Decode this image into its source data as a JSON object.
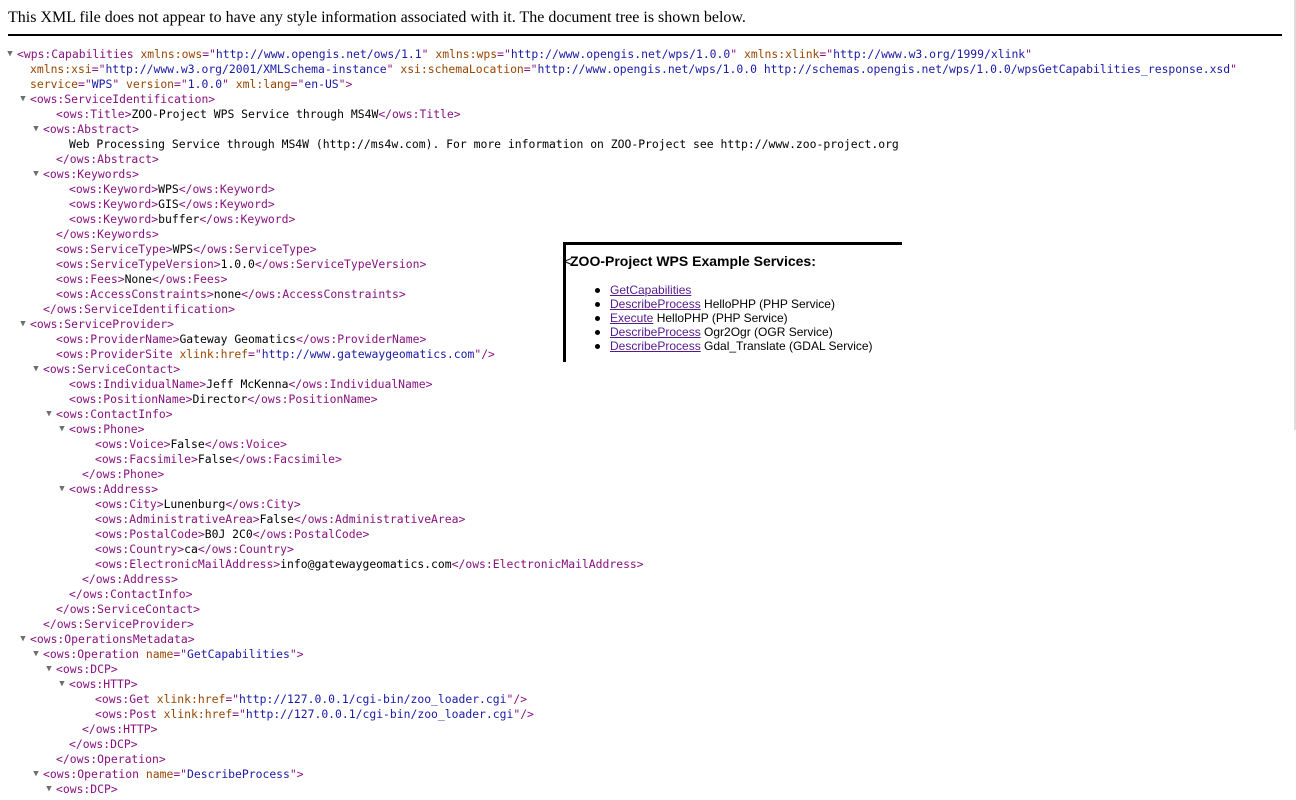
{
  "header": {
    "notice": "This XML file does not appear to have any style information associated with it. The document tree is shown below."
  },
  "xml_lines": [
    {
      "indent": 0,
      "toggle": true,
      "parts": [
        [
          "t",
          "<wps:Capabilities"
        ],
        [
          "s",
          " "
        ],
        [
          "an",
          "xmlns:ows"
        ],
        [
          "t",
          "=\""
        ],
        [
          "av",
          "http://www.opengis.net/ows/1.1"
        ],
        [
          "t",
          "\""
        ],
        [
          "s",
          " "
        ],
        [
          "an",
          "xmlns:wps"
        ],
        [
          "t",
          "=\""
        ],
        [
          "av",
          "http://www.opengis.net/wps/1.0.0"
        ],
        [
          "t",
          "\""
        ],
        [
          "s",
          " "
        ],
        [
          "an",
          "xmlns:xlink"
        ],
        [
          "t",
          "=\""
        ],
        [
          "av",
          "http://www.w3.org/1999/xlink"
        ],
        [
          "t",
          "\""
        ]
      ]
    },
    {
      "indent": 1,
      "parts": [
        [
          "an",
          "xmlns:xsi"
        ],
        [
          "t",
          "=\""
        ],
        [
          "av",
          "http://www.w3.org/2001/XMLSchema-instance"
        ],
        [
          "t",
          "\""
        ],
        [
          "s",
          " "
        ],
        [
          "an",
          "xsi:schemaLocation"
        ],
        [
          "t",
          "=\""
        ],
        [
          "av",
          "http://www.opengis.net/wps/1.0.0 http://schemas.opengis.net/wps/1.0.0/wpsGetCapabilities_response.xsd"
        ],
        [
          "t",
          "\""
        ]
      ]
    },
    {
      "indent": 1,
      "parts": [
        [
          "an",
          "service"
        ],
        [
          "t",
          "=\""
        ],
        [
          "av",
          "WPS"
        ],
        [
          "t",
          "\""
        ],
        [
          "s",
          " "
        ],
        [
          "an",
          "version"
        ],
        [
          "t",
          "=\""
        ],
        [
          "av",
          "1.0.0"
        ],
        [
          "t",
          "\""
        ],
        [
          "s",
          " "
        ],
        [
          "an",
          "xml:lang"
        ],
        [
          "t",
          "=\""
        ],
        [
          "av",
          "en-US"
        ],
        [
          "t",
          "\">"
        ]
      ]
    },
    {
      "indent": 1,
      "toggle": true,
      "parts": [
        [
          "t",
          "<ows:ServiceIdentification>"
        ]
      ]
    },
    {
      "indent": 3,
      "parts": [
        [
          "t",
          "<ows:Title>"
        ],
        [
          "tx",
          "ZOO-Project WPS Service through MS4W"
        ],
        [
          "t",
          "</ows:Title>"
        ]
      ]
    },
    {
      "indent": 2,
      "toggle": true,
      "parts": [
        [
          "t",
          "<ows:Abstract>"
        ]
      ]
    },
    {
      "indent": 4,
      "parts": [
        [
          "tx",
          "Web Processing Service through MS4W (http://ms4w.com). For more information on ZOO-Project see http://www.zoo-project.org"
        ]
      ]
    },
    {
      "indent": 3,
      "parts": [
        [
          "t",
          "</ows:Abstract>"
        ]
      ]
    },
    {
      "indent": 2,
      "toggle": true,
      "parts": [
        [
          "t",
          "<ows:Keywords>"
        ]
      ]
    },
    {
      "indent": 4,
      "parts": [
        [
          "t",
          "<ows:Keyword>"
        ],
        [
          "tx",
          "WPS"
        ],
        [
          "t",
          "</ows:Keyword>"
        ]
      ]
    },
    {
      "indent": 4,
      "parts": [
        [
          "t",
          "<ows:Keyword>"
        ],
        [
          "tx",
          "GIS"
        ],
        [
          "t",
          "</ows:Keyword>"
        ]
      ]
    },
    {
      "indent": 4,
      "parts": [
        [
          "t",
          "<ows:Keyword>"
        ],
        [
          "tx",
          "buffer"
        ],
        [
          "t",
          "</ows:Keyword>"
        ]
      ]
    },
    {
      "indent": 3,
      "parts": [
        [
          "t",
          "</ows:Keywords>"
        ]
      ]
    },
    {
      "indent": 3,
      "parts": [
        [
          "t",
          "<ows:ServiceType>"
        ],
        [
          "tx",
          "WPS"
        ],
        [
          "t",
          "</ows:ServiceType>"
        ]
      ]
    },
    {
      "indent": 3,
      "parts": [
        [
          "t",
          "<ows:ServiceTypeVersion>"
        ],
        [
          "tx",
          "1.0.0"
        ],
        [
          "t",
          "</ows:ServiceTypeVersion>"
        ]
      ]
    },
    {
      "indent": 3,
      "parts": [
        [
          "t",
          "<ows:Fees>"
        ],
        [
          "tx",
          "None"
        ],
        [
          "t",
          "</ows:Fees>"
        ]
      ]
    },
    {
      "indent": 3,
      "parts": [
        [
          "t",
          "<ows:AccessConstraints>"
        ],
        [
          "tx",
          "none"
        ],
        [
          "t",
          "</ows:AccessConstraints>"
        ]
      ]
    },
    {
      "indent": 2,
      "parts": [
        [
          "t",
          "</ows:ServiceIdentification>"
        ]
      ]
    },
    {
      "indent": 1,
      "toggle": true,
      "parts": [
        [
          "t",
          "<ows:ServiceProvider>"
        ]
      ]
    },
    {
      "indent": 3,
      "parts": [
        [
          "t",
          "<ows:ProviderName>"
        ],
        [
          "tx",
          "Gateway Geomatics"
        ],
        [
          "t",
          "</ows:ProviderName>"
        ]
      ]
    },
    {
      "indent": 3,
      "parts": [
        [
          "t",
          "<ows:ProviderSite"
        ],
        [
          "s",
          " "
        ],
        [
          "an",
          "xlink:href"
        ],
        [
          "t",
          "=\""
        ],
        [
          "av",
          "http://www.gatewaygeomatics.com"
        ],
        [
          "t",
          "\"/>"
        ]
      ]
    },
    {
      "indent": 2,
      "toggle": true,
      "parts": [
        [
          "t",
          "<ows:ServiceContact>"
        ]
      ]
    },
    {
      "indent": 4,
      "parts": [
        [
          "t",
          "<ows:IndividualName>"
        ],
        [
          "tx",
          "Jeff McKenna"
        ],
        [
          "t",
          "</ows:IndividualName>"
        ]
      ]
    },
    {
      "indent": 4,
      "parts": [
        [
          "t",
          "<ows:PositionName>"
        ],
        [
          "tx",
          "Director"
        ],
        [
          "t",
          "</ows:PositionName>"
        ]
      ]
    },
    {
      "indent": 3,
      "toggle": true,
      "parts": [
        [
          "t",
          "<ows:ContactInfo>"
        ]
      ]
    },
    {
      "indent": 4,
      "toggle": true,
      "parts": [
        [
          "t",
          "<ows:Phone>"
        ]
      ]
    },
    {
      "indent": 6,
      "parts": [
        [
          "t",
          "<ows:Voice>"
        ],
        [
          "tx",
          "False"
        ],
        [
          "t",
          "</ows:Voice>"
        ]
      ]
    },
    {
      "indent": 6,
      "parts": [
        [
          "t",
          "<ows:Facsimile>"
        ],
        [
          "tx",
          "False"
        ],
        [
          "t",
          "</ows:Facsimile>"
        ]
      ]
    },
    {
      "indent": 5,
      "parts": [
        [
          "t",
          "</ows:Phone>"
        ]
      ]
    },
    {
      "indent": 4,
      "toggle": true,
      "parts": [
        [
          "t",
          "<ows:Address>"
        ]
      ]
    },
    {
      "indent": 6,
      "parts": [
        [
          "t",
          "<ows:City>"
        ],
        [
          "tx",
          "Lunenburg"
        ],
        [
          "t",
          "</ows:City>"
        ]
      ]
    },
    {
      "indent": 6,
      "parts": [
        [
          "t",
          "<ows:AdministrativeArea>"
        ],
        [
          "tx",
          "False"
        ],
        [
          "t",
          "</ows:AdministrativeArea>"
        ]
      ]
    },
    {
      "indent": 6,
      "parts": [
        [
          "t",
          "<ows:PostalCode>"
        ],
        [
          "tx",
          "B0J 2C0"
        ],
        [
          "t",
          "</ows:PostalCode>"
        ]
      ]
    },
    {
      "indent": 6,
      "parts": [
        [
          "t",
          "<ows:Country>"
        ],
        [
          "tx",
          "ca"
        ],
        [
          "t",
          "</ows:Country>"
        ]
      ]
    },
    {
      "indent": 6,
      "parts": [
        [
          "t",
          "<ows:ElectronicMailAddress>"
        ],
        [
          "tx",
          "info@gatewaygeomatics.com"
        ],
        [
          "t",
          "</ows:ElectronicMailAddress>"
        ]
      ]
    },
    {
      "indent": 5,
      "parts": [
        [
          "t",
          "</ows:Address>"
        ]
      ]
    },
    {
      "indent": 4,
      "parts": [
        [
          "t",
          "</ows:ContactInfo>"
        ]
      ]
    },
    {
      "indent": 3,
      "parts": [
        [
          "t",
          "</ows:ServiceContact>"
        ]
      ]
    },
    {
      "indent": 2,
      "parts": [
        [
          "t",
          "</ows:ServiceProvider>"
        ]
      ]
    },
    {
      "indent": 1,
      "toggle": true,
      "parts": [
        [
          "t",
          "<ows:OperationsMetadata>"
        ]
      ]
    },
    {
      "indent": 2,
      "toggle": true,
      "parts": [
        [
          "t",
          "<ows:Operation"
        ],
        [
          "s",
          " "
        ],
        [
          "an",
          "name"
        ],
        [
          "t",
          "=\""
        ],
        [
          "av",
          "GetCapabilities"
        ],
        [
          "t",
          "\">"
        ]
      ]
    },
    {
      "indent": 3,
      "toggle": true,
      "parts": [
        [
          "t",
          "<ows:DCP>"
        ]
      ]
    },
    {
      "indent": 4,
      "toggle": true,
      "parts": [
        [
          "t",
          "<ows:HTTP>"
        ]
      ]
    },
    {
      "indent": 6,
      "parts": [
        [
          "t",
          "<ows:Get"
        ],
        [
          "s",
          " "
        ],
        [
          "an",
          "xlink:href"
        ],
        [
          "t",
          "=\""
        ],
        [
          "av",
          "http://127.0.0.1/cgi-bin/zoo_loader.cgi"
        ],
        [
          "t",
          "\"/>"
        ]
      ]
    },
    {
      "indent": 6,
      "parts": [
        [
          "t",
          "<ows:Post"
        ],
        [
          "s",
          " "
        ],
        [
          "an",
          "xlink:href"
        ],
        [
          "t",
          "=\""
        ],
        [
          "av",
          "http://127.0.0.1/cgi-bin/zoo_loader.cgi"
        ],
        [
          "t",
          "\"/>"
        ]
      ]
    },
    {
      "indent": 5,
      "parts": [
        [
          "t",
          "</ows:HTTP>"
        ]
      ]
    },
    {
      "indent": 4,
      "parts": [
        [
          "t",
          "</ows:DCP>"
        ]
      ]
    },
    {
      "indent": 3,
      "parts": [
        [
          "t",
          "</ows:Operation>"
        ]
      ]
    },
    {
      "indent": 2,
      "toggle": true,
      "parts": [
        [
          "t",
          "<ows:Operation"
        ],
        [
          "s",
          " "
        ],
        [
          "an",
          "name"
        ],
        [
          "t",
          "=\""
        ],
        [
          "av",
          "DescribeProcess"
        ],
        [
          "t",
          "\">"
        ]
      ]
    },
    {
      "indent": 3,
      "toggle": true,
      "parts": [
        [
          "t",
          "<ows:DCP>"
        ]
      ]
    }
  ],
  "overlay": {
    "title": "ZOO-Project WPS Example Services:",
    "lead_char": "<",
    "services": [
      {
        "link": "GetCapabilities",
        "rest": ""
      },
      {
        "link": "DescribeProcess",
        "rest": " HelloPHP (PHP Service)"
      },
      {
        "link": "Execute",
        "rest": " HelloPHP (PHP Service)"
      },
      {
        "link": "DescribeProcess",
        "rest": " Ogr2Ogr (OGR Service)"
      },
      {
        "link": "DescribeProcess",
        "rest": " Gdal_Translate (GDAL Service)"
      }
    ]
  },
  "icons": {
    "expand_toggle": "triangle-down-icon"
  }
}
